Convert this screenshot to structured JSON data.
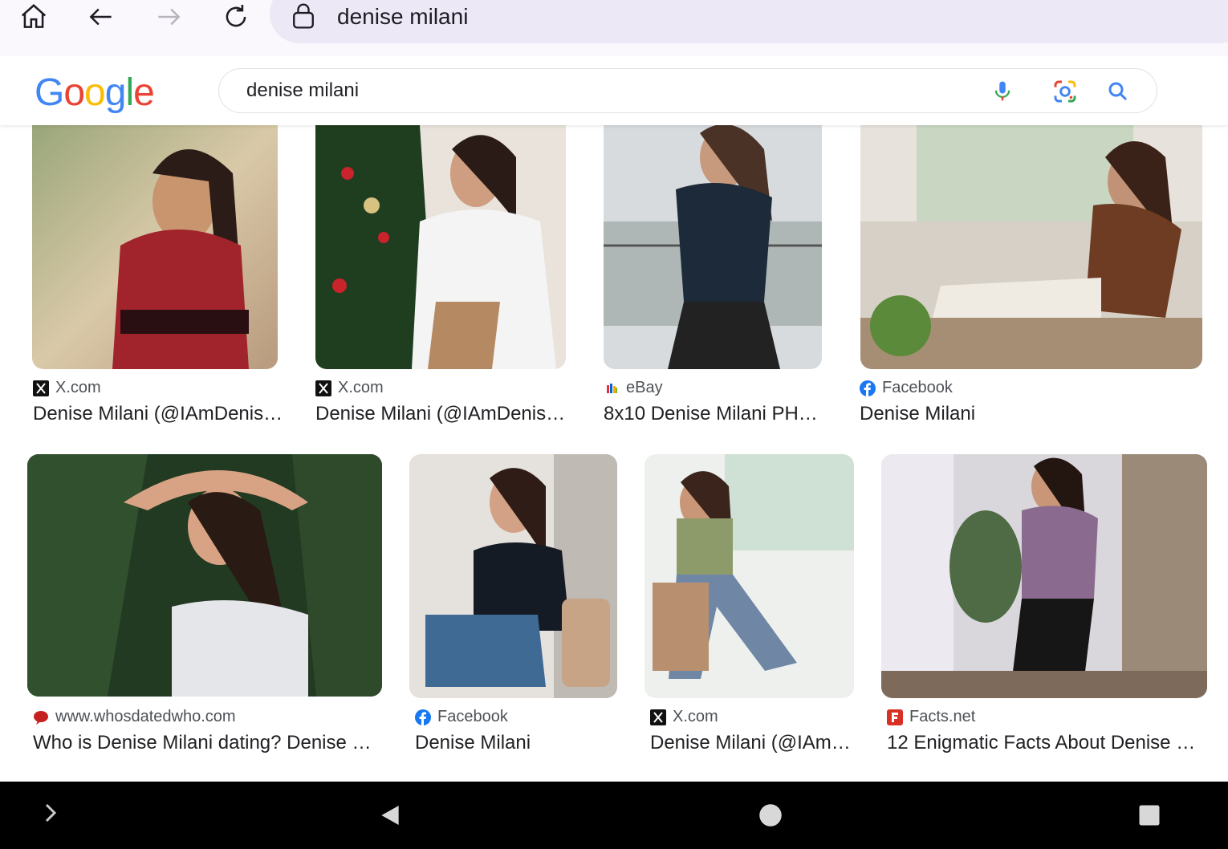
{
  "browser": {
    "url_text": "denise milani",
    "icons": [
      "home-icon",
      "back-icon",
      "forward-icon",
      "reload-icon",
      "lock-icon"
    ]
  },
  "google": {
    "logo": [
      "G",
      "o",
      "o",
      "g",
      "l",
      "e"
    ],
    "logo_colors": [
      "#4285F4",
      "#EA4335",
      "#FBBC05",
      "#4285F4",
      "#34A853",
      "#EA4335"
    ],
    "query": "denise milani",
    "icons": [
      "mic-icon",
      "lens-icon",
      "search-icon"
    ]
  },
  "results": [
    {
      "source": "X.com",
      "source_icon": "x-icon",
      "title": "Denise Milani (@IAmDenis…"
    },
    {
      "source": "X.com",
      "source_icon": "x-icon",
      "title": "Denise Milani (@IAmDenis…"
    },
    {
      "source": "eBay",
      "source_icon": "ebay-icon",
      "title": "8x10 Denise Milani PH…"
    },
    {
      "source": "Facebook",
      "source_icon": "facebook-icon",
      "title": "Denise Milani"
    },
    {
      "source": "www.whosdatedwho.com",
      "source_icon": "whosdatedwho-icon",
      "title": "Who is Denise Milani dating? Denise …"
    },
    {
      "source": "Facebook",
      "source_icon": "facebook-icon",
      "title": "Denise Milani"
    },
    {
      "source": "X.com",
      "source_icon": "x-icon",
      "title": "Denise Milani (@IAm…"
    },
    {
      "source": "Facts.net",
      "source_icon": "factsnet-icon",
      "title": "12 Enigmatic Facts About Denise …"
    }
  ],
  "colors": {
    "facebook": "#1877F2",
    "facts": "#D93025",
    "whosdatedwho": "#C5221F"
  },
  "android_nav": [
    "expand-icon",
    "back-triangle-icon",
    "home-circle-icon",
    "recents-square-icon"
  ]
}
